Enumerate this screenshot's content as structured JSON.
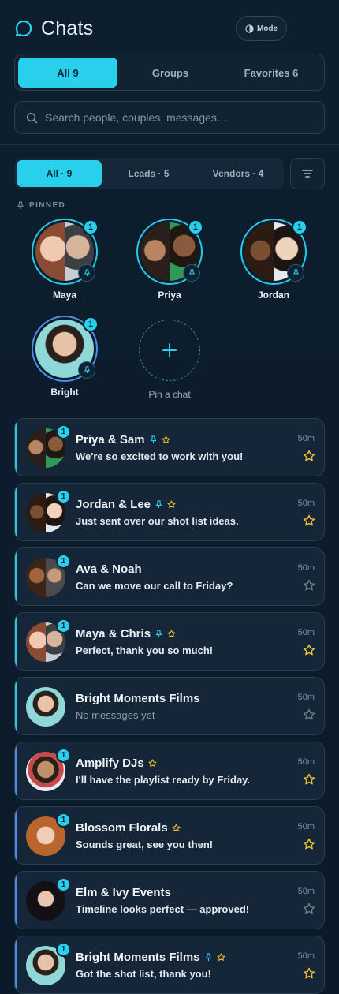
{
  "header": {
    "title": "Chats",
    "mode_label": "Mode"
  },
  "tabs_top": [
    {
      "label": "All 9",
      "active": true
    },
    {
      "label": "Groups",
      "active": false
    },
    {
      "label": "Favorites 6",
      "active": false
    }
  ],
  "search": {
    "placeholder": "Search people, couples, messages…"
  },
  "filters": [
    {
      "label": "All · 9",
      "active": true
    },
    {
      "label": "Leads · 5",
      "active": false
    },
    {
      "label": "Vendors · 4",
      "active": false
    }
  ],
  "pinned": {
    "section_label": "PINNED",
    "items": [
      {
        "name": "Maya",
        "badge": "1"
      },
      {
        "name": "Priya",
        "badge": "1"
      },
      {
        "name": "Jordan",
        "badge": "1"
      },
      {
        "name": "Bright",
        "badge": "1"
      }
    ],
    "add_label": "Pin a chat"
  },
  "chats": [
    {
      "name": "Priya & Sam",
      "message": "We're so excited to work with you!",
      "time": "50m",
      "badge": "1",
      "pinned": true,
      "favorite": true,
      "unread": true
    },
    {
      "name": "Jordan & Lee",
      "message": "Just sent over our shot list ideas.",
      "time": "50m",
      "badge": "1",
      "pinned": true,
      "favorite": true,
      "unread": true
    },
    {
      "name": "Ava & Noah",
      "message": "Can we move our call to Friday?",
      "time": "50m",
      "badge": "1",
      "pinned": false,
      "favorite": false,
      "unread": true
    },
    {
      "name": "Maya & Chris",
      "message": "Perfect, thank you so much!",
      "time": "50m",
      "badge": "1",
      "pinned": true,
      "favorite": true,
      "unread": true
    },
    {
      "name": "Bright Moments Films",
      "message": "No messages yet",
      "time": "50m",
      "badge": "",
      "pinned": false,
      "favorite": false,
      "unread": false
    },
    {
      "name": "Amplify DJs",
      "message": "I'll have the playlist ready by Friday.",
      "time": "50m",
      "badge": "1",
      "pinned": false,
      "favorite": true,
      "unread": true
    },
    {
      "name": "Blossom Florals",
      "message": "Sounds great, see you then!",
      "time": "50m",
      "badge": "1",
      "pinned": false,
      "favorite": true,
      "unread": true
    },
    {
      "name": "Elm & Ivy Events",
      "message": "Timeline looks perfect — approved!",
      "time": "50m",
      "badge": "1",
      "pinned": false,
      "favorite": false,
      "unread": true
    },
    {
      "name": "Bright Moments Films",
      "message": "Got the shot list, thank you!",
      "time": "50m",
      "badge": "1",
      "pinned": true,
      "favorite": true,
      "unread": true
    }
  ],
  "colors": {
    "accent": "#28d0ec",
    "lead_accent": "#28c8e6",
    "vendor_accent": "#4e8ee6",
    "star": "#f2c230",
    "background": "#0c1c2c"
  }
}
